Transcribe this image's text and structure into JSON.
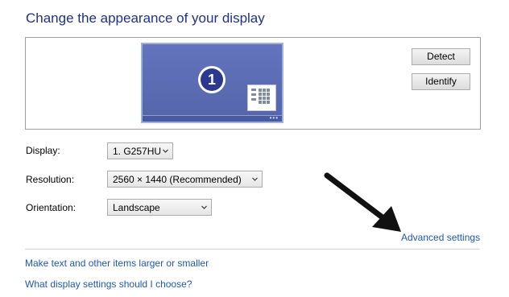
{
  "header": {
    "title": "Change the appearance of your display"
  },
  "preview": {
    "monitor_number": "1",
    "detect_label": "Detect",
    "identify_label": "Identify"
  },
  "settings": {
    "display_label": "Display:",
    "display_value": "1. G257HU",
    "resolution_label": "Resolution:",
    "resolution_value": "2560 × 1440 (Recommended)",
    "orientation_label": "Orientation:",
    "orientation_value": "Landscape"
  },
  "links": {
    "advanced": "Advanced settings",
    "text_size": "Make text and other items larger or smaller",
    "help": "What display settings should I choose?"
  }
}
